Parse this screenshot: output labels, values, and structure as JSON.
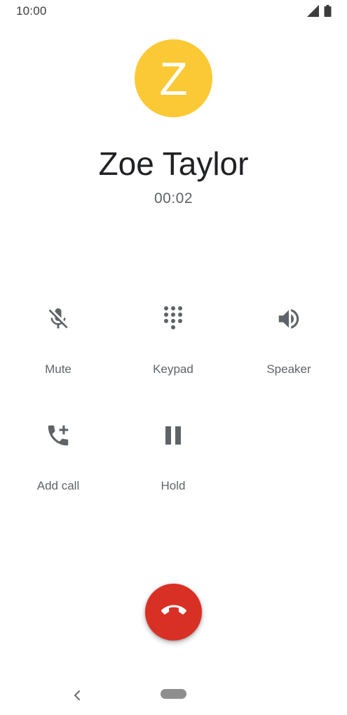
{
  "status_bar": {
    "time": "10:00",
    "icons": [
      "signal-icon",
      "battery-icon"
    ]
  },
  "contact": {
    "initial": "Z",
    "name": "Zoe Taylor",
    "avatar_color": "#fbc935"
  },
  "call": {
    "timer": "00:02"
  },
  "actions": [
    {
      "label": "Mute",
      "icon": "mic-off-icon"
    },
    {
      "label": "Keypad",
      "icon": "dialpad-icon"
    },
    {
      "label": "Speaker",
      "icon": "speaker-icon"
    },
    {
      "label": "Add call",
      "icon": "add-call-icon"
    },
    {
      "label": "Hold",
      "icon": "pause-icon"
    }
  ],
  "end_call": {
    "icon": "call-end-icon",
    "color": "#d93025"
  },
  "nav": {
    "icons": [
      "back-icon",
      "home-pill"
    ]
  }
}
